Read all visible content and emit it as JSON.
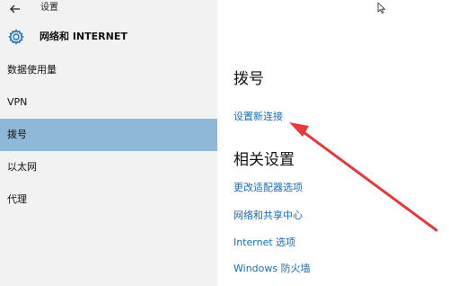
{
  "window": {
    "title": "设置"
  },
  "header": {
    "title": "网络和 INTERNET"
  },
  "sidebar": {
    "items": [
      {
        "label": "数据使用量",
        "selected": false
      },
      {
        "label": "VPN",
        "selected": false
      },
      {
        "label": "拨号",
        "selected": true
      },
      {
        "label": "以太网",
        "selected": false
      },
      {
        "label": "代理",
        "selected": false
      }
    ]
  },
  "main": {
    "section_title": "拨号",
    "setup_link": "设置新连接",
    "related_title": "相关设置",
    "related_links": [
      "更改适配器选项",
      "网络和共享中心",
      "Internet 选项",
      "Windows 防火墙"
    ]
  },
  "colors": {
    "sidebar_bg": "#f2f2f2",
    "selected_bg": "#8fb7d8",
    "link": "#1a6bb8",
    "annotation_arrow": "#e8393a"
  },
  "icons": {
    "back": "back-arrow-icon",
    "settings": "gear-icon",
    "cursor": "mouse-pointer-icon"
  }
}
